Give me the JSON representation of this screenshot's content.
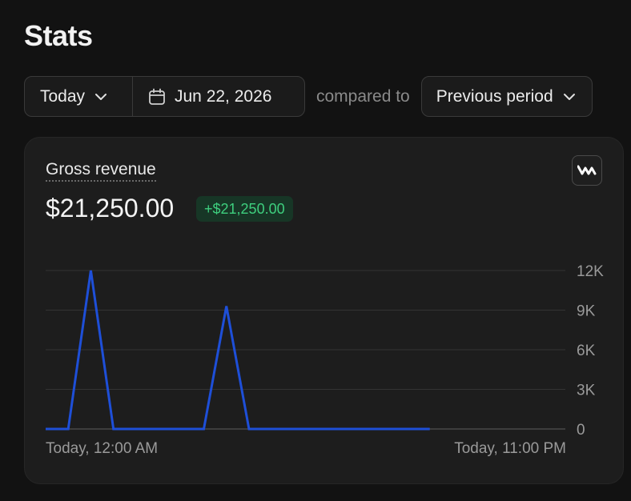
{
  "page": {
    "title": "Stats"
  },
  "controls": {
    "period": "Today",
    "date": "Jun 22, 2026",
    "compared_label": "compared to",
    "comparison": "Previous period"
  },
  "card": {
    "metric_label": "Gross revenue",
    "metric_value": "$21,250.00",
    "delta": "+$21,250.00",
    "x_start": "Today, 12:00 AM",
    "x_end": "Today, 11:00 PM"
  },
  "colors": {
    "line": "#1e4fd8",
    "delta_text": "#3ecf7e",
    "delta_bg": "#173626",
    "grid": "#333333"
  },
  "chart_data": {
    "type": "line",
    "x": [
      0,
      1,
      2,
      3,
      4,
      5,
      6,
      7,
      8,
      9,
      10,
      11,
      12,
      13,
      14,
      15,
      16,
      17,
      18,
      19,
      20,
      21,
      22,
      23
    ],
    "y": [
      0,
      0,
      12000,
      0,
      0,
      0,
      0,
      0,
      9300,
      0,
      0,
      0,
      0,
      0,
      0,
      0,
      0,
      0,
      null,
      null,
      null,
      null,
      null,
      null
    ],
    "y_ticks": [
      "0",
      "3K",
      "6K",
      "9K",
      "12K"
    ],
    "y_tick_values": [
      0,
      3000,
      6000,
      9000,
      12000
    ],
    "ylim": [
      0,
      12000
    ],
    "xlim": [
      0,
      23
    ],
    "grid": true,
    "y_axis_side": "right"
  }
}
